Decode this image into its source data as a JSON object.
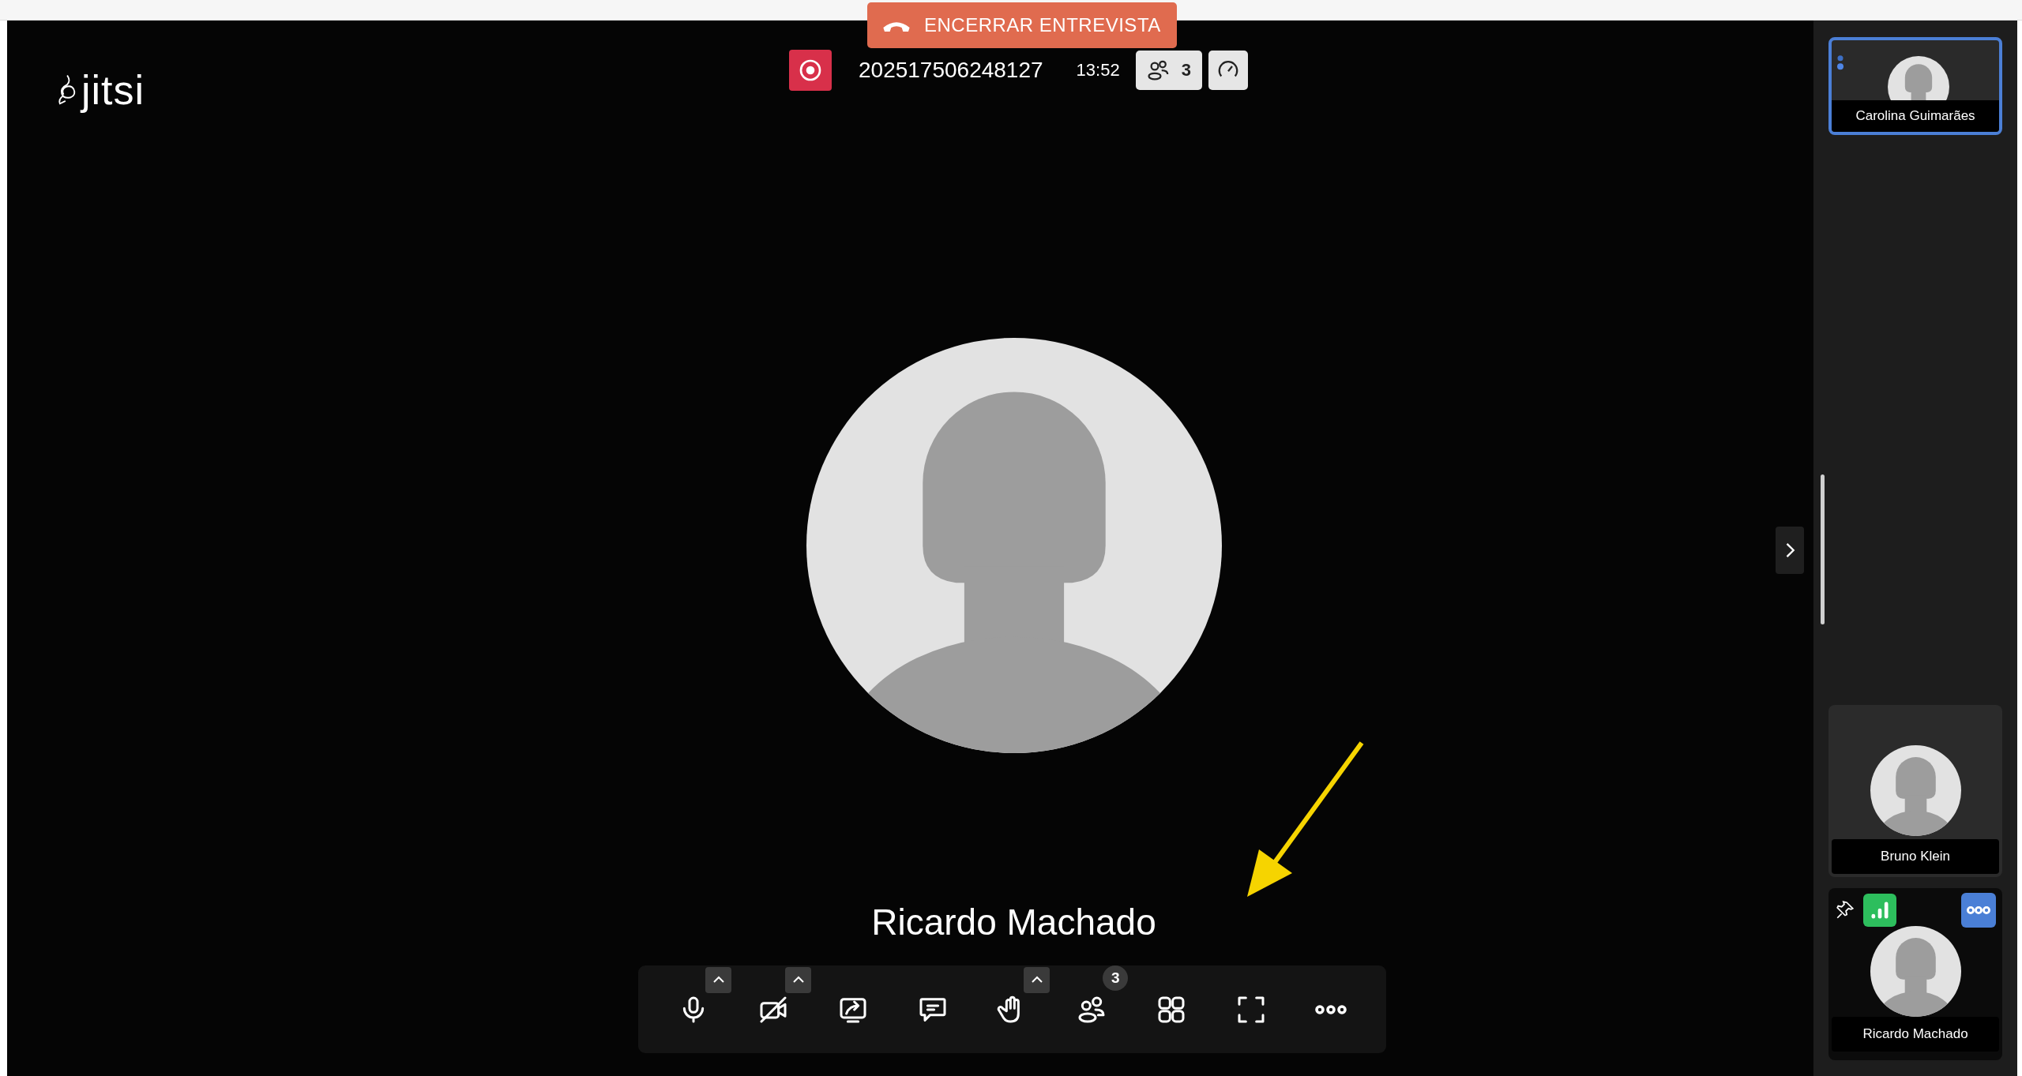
{
  "top_bar": {
    "end_button": {
      "label": "ENCERRAR ENTREVISTA"
    },
    "recording": true,
    "meeting_id": "202517506248127",
    "time": "13:52",
    "participant_count": "3"
  },
  "logo": {
    "text": "jitsi"
  },
  "stage": {
    "speaker_name": "Ricardo Machado"
  },
  "toolbar": [
    {
      "kind": "mic",
      "has_menu": true
    },
    {
      "kind": "camera",
      "muted": true,
      "has_menu": true
    },
    {
      "kind": "share",
      "has_menu": false
    },
    {
      "kind": "chat",
      "has_menu": false
    },
    {
      "kind": "hand",
      "has_menu": true
    },
    {
      "kind": "participants",
      "has_menu": false,
      "badge": "3"
    },
    {
      "kind": "tiles",
      "has_menu": false
    },
    {
      "kind": "fullscreen",
      "has_menu": false
    },
    {
      "kind": "more",
      "has_menu": false
    }
  ],
  "sidebar": {
    "tiles": [
      {
        "name": "Carolina Guimarães",
        "kind": "speaker",
        "selected": true,
        "controls": false
      },
      {
        "name": "Bruno Klein",
        "kind": "remote",
        "selected": false,
        "controls": false
      },
      {
        "name": "Ricardo Machado",
        "kind": "local",
        "selected": false,
        "controls": true
      }
    ]
  },
  "annotation": {
    "arrow": true
  }
}
